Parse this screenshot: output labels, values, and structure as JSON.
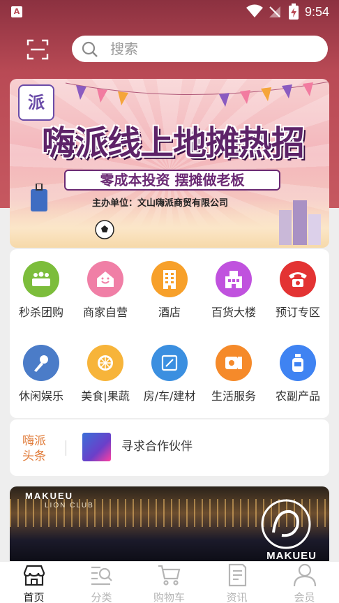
{
  "status_bar": {
    "time": "9:54",
    "app_indicator": "A"
  },
  "search": {
    "placeholder": "搜索"
  },
  "banner": {
    "logo_text": "派",
    "headline": "嗨派线上地摊热招",
    "subline": "零成本投资  摆摊做老板",
    "organizer": "主办单位：文山嗨派商贸有限公司"
  },
  "categories": [
    {
      "label": "秒杀团购",
      "color": "#7cbd3b",
      "icon": "group-icon"
    },
    {
      "label": "商家自营",
      "color": "#f07fa6",
      "icon": "shop-face-icon"
    },
    {
      "label": "酒店",
      "color": "#f7a02a",
      "icon": "building-icon"
    },
    {
      "label": "百货大楼",
      "color": "#c052de",
      "icon": "department-store-icon"
    },
    {
      "label": "预订专区",
      "color": "#e33333",
      "icon": "telephone-icon"
    },
    {
      "label": "休闲娱乐",
      "color": "#4b7cc8",
      "icon": "microphone-icon"
    },
    {
      "label": "美食|果蔬",
      "color": "#f7b43a",
      "icon": "orange-slice-icon"
    },
    {
      "label": "房/车/建材",
      "color": "#3b8fe0",
      "icon": "ruler-icon"
    },
    {
      "label": "生活服务",
      "color": "#f58a2a",
      "icon": "tissue-roll-icon"
    },
    {
      "label": "农副产品",
      "color": "#3f83f2",
      "icon": "bottle-icon"
    }
  ],
  "news": {
    "tag": "嗨派头条",
    "headline": "寻求合作伙伴"
  },
  "venue": {
    "sign": "MAKUEU",
    "sub": "LION CLUB",
    "brand": "MAKUEU"
  },
  "tabs": [
    {
      "label": "首页",
      "icon": "home-icon",
      "active": true
    },
    {
      "label": "分类",
      "icon": "search-list-icon",
      "active": false
    },
    {
      "label": "购物车",
      "icon": "cart-icon",
      "active": false
    },
    {
      "label": "资讯",
      "icon": "news-icon",
      "active": false
    },
    {
      "label": "会员",
      "icon": "user-icon",
      "active": false
    }
  ]
}
